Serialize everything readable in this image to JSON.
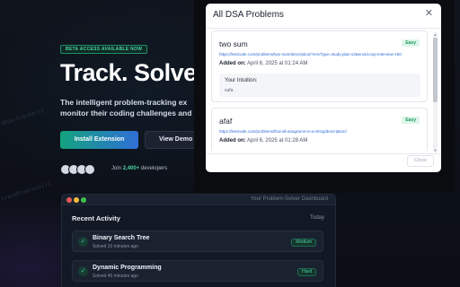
{
  "hero": {
    "badge": "BETA ACCESS AVAILABLE NOW",
    "title": "Track. Solve",
    "subtitle_line1": "The intelligent problem-tracking ex",
    "subtitle_line2": "monitor their coding challenges and",
    "install_label": "Install Extension",
    "demo_label": "View Demo",
    "joined_prefix": "Join",
    "joined_count": "2,400+",
    "joined_suffix": "developers"
  },
  "background_code": {
    "line1": "//DSA:Tracker()",
    "line2": "trackProgress(){"
  },
  "dashboard": {
    "title": "Your Problem-Solver Dashboard",
    "section_title": "Recent Activity",
    "period": "Today",
    "activities": [
      {
        "title": "Binary Search Tree",
        "time": "Solved 10 minutes ago",
        "level": "Medium"
      },
      {
        "title": "Dynamic Programming",
        "time": "Solved 45 minutes ago",
        "level": "Hard"
      }
    ]
  },
  "modal": {
    "title": "All DSA Problems",
    "close_label": "Close",
    "added_label": "Added on:",
    "intuition_label": "Your Intuition:",
    "problems": [
      {
        "name": "two sum",
        "difficulty": "Easy",
        "url": "https://leetcode.com/problems/two-sum/description/?envType=study-plan-v2&envId=top-interview-150",
        "added": "April 6, 2025 at 01:24 AM",
        "intuition": "safa"
      },
      {
        "name": "afaf",
        "difficulty": "Easy",
        "url": "https://leetcode.com/problems/find-all-anagrams-in-a-string/description/",
        "added": "April 6, 2025 at 01:28 AM",
        "intuition": ""
      }
    ]
  },
  "colors": {
    "accent_green": "#4fd3a0",
    "accent_blue": "#2f6fd6",
    "page_bg": "#0c0f17"
  }
}
